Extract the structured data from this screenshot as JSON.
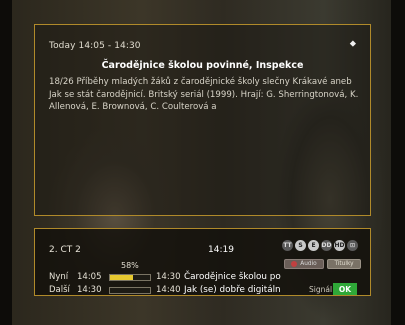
{
  "epg": {
    "time_range": "Today 14:05 - 14:30",
    "nav_arrow": "⬥",
    "title": "Čarodějnice školou povinné, Inspekce",
    "description": "18/26 Příběhy mladých žáků z čarodějnické školy slečny Krákavé aneb Jak se stát čarodějnicí. Britský seriál (1999). Hrají: G. Sherringtonová, K. Allenová, E. Brownová, C. Coulterová a"
  },
  "banner": {
    "channel": "2. CT 2",
    "clock": "14:19",
    "progress_percent_label": "58%",
    "progress_fraction": 0.58,
    "now": {
      "label": "Nyní",
      "start": "14:05",
      "end": "14:30",
      "title": "Čarodějnice školou po"
    },
    "next": {
      "label": "Další",
      "start": "14:30",
      "end": "14:40",
      "title": "Jak (se) dobře digitáln"
    },
    "status_icons": [
      {
        "name": "teletext-icon",
        "glyph": "TT"
      },
      {
        "name": "subtitle-icon",
        "glyph": "S"
      },
      {
        "name": "epg-icon",
        "glyph": "E"
      },
      {
        "name": "dolby-icon",
        "glyph": "DD"
      },
      {
        "name": "hd-icon",
        "glyph": "HD"
      },
      {
        "name": "lock-icon",
        "glyph": "⊡"
      }
    ],
    "audio_pill": "Audio",
    "subtitle_pill": "Titulky",
    "signal_label": "Signál",
    "signal_status": "OK"
  },
  "colors": {
    "border_gold": "#b08a2a",
    "progress_fill": "#e6c830",
    "signal_ok": "#2fa838"
  }
}
